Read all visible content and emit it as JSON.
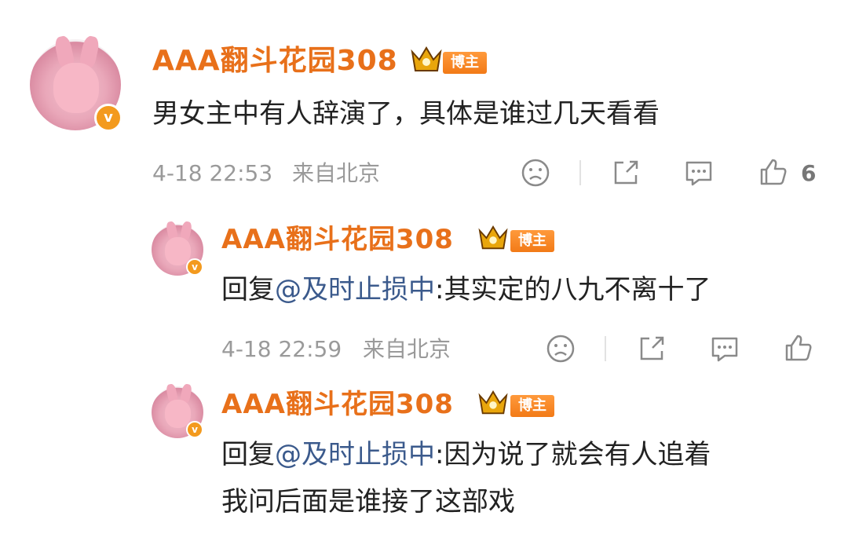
{
  "comments": [
    {
      "author": "AAA翻斗花园308",
      "badge": "博主",
      "text_plain": "男女主中有人辞演了，具体是谁过几天看看",
      "time": "4-18 22:53",
      "location": "来自北京",
      "likes": "6"
    },
    {
      "author": "AAA翻斗花园308",
      "badge": "博主",
      "reply_prefix": "回复",
      "mention": "@及时止损中",
      "text_after": ":其实定的八九不离十了",
      "time": "4-18 22:59",
      "location": "来自北京"
    },
    {
      "author": "AAA翻斗花园308",
      "badge": "博主",
      "reply_prefix": "回复",
      "mention": "@及时止损中",
      "text_after": ":因为说了就会有人追着",
      "text_line2": "我问后面是谁接了这部戏"
    }
  ],
  "icons": [
    "sad-face-icon",
    "share-icon",
    "comment-icon",
    "thumbs-up-icon",
    "crown-icon",
    "verified-v-icon"
  ],
  "colors": {
    "name": "#e8701a",
    "mention": "#3b5a8c",
    "meta": "#9a9a9a",
    "badge": "#f27a17"
  }
}
